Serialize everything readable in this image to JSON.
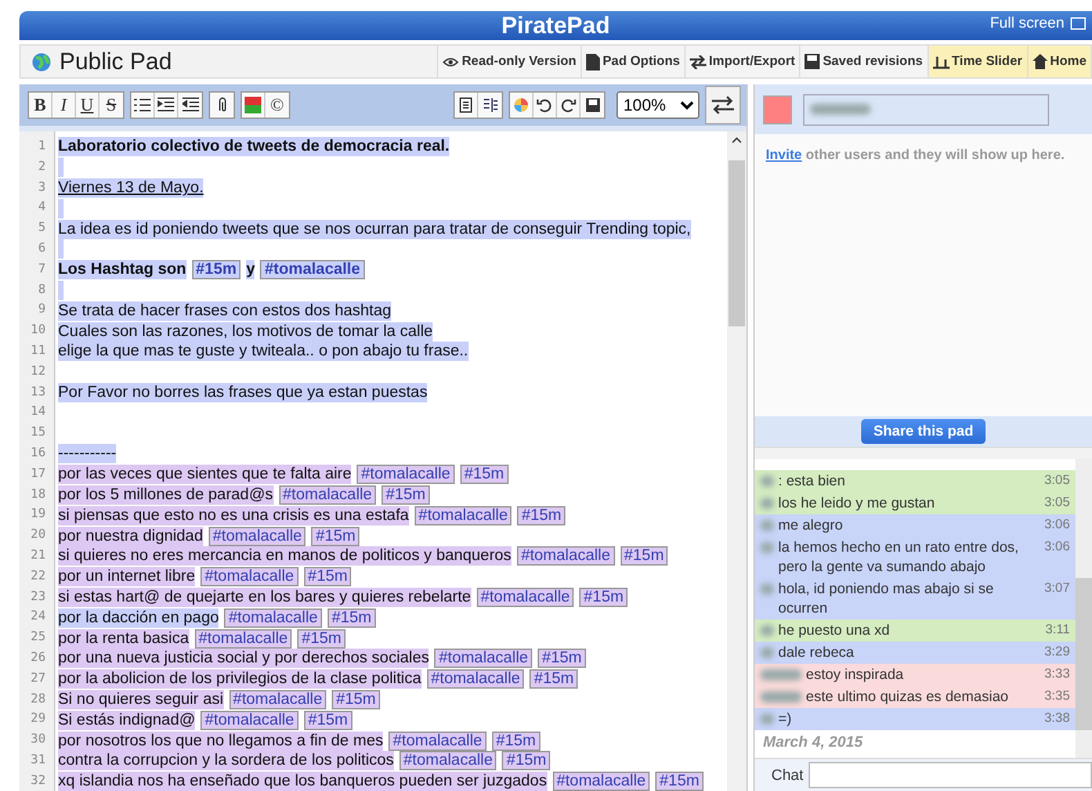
{
  "header": {
    "title": "PiratePad",
    "fullscreen": "Full screen"
  },
  "pad": {
    "title": "Public Pad"
  },
  "pad_actions": [
    {
      "label": "Read-only Version",
      "highlighted": false
    },
    {
      "label": "Pad Options",
      "highlighted": false
    },
    {
      "label": "Import/Export",
      "highlighted": false
    },
    {
      "label": "Saved revisions",
      "highlighted": false
    },
    {
      "label": "Time Slider",
      "highlighted": true
    },
    {
      "label": "Home",
      "highlighted": true
    }
  ],
  "format_buttons": [
    "B",
    "I",
    "U",
    "S"
  ],
  "copyright_button": "©",
  "zoom": "100%",
  "lines": [
    {
      "number": "1",
      "segments": [
        {
          "kind": "text",
          "text": "Laboratorio colectivo de tweets de democracia real.",
          "color": "#c8d0fa",
          "bold": true,
          "underline": false
        }
      ]
    },
    {
      "number": "2",
      "color": "#c8d0fa"
    },
    {
      "number": "3",
      "segments": [
        {
          "kind": "text",
          "text": " Viernes 13 de Mayo. ",
          "color": "#c8d0fa",
          "bold": false,
          "underline": true
        }
      ]
    },
    {
      "number": "4",
      "color": "#c8d0fa"
    },
    {
      "number": "5",
      "segments": [
        {
          "kind": "text",
          "text": " La idea es id poniendo tweets que se nos ocurran para tratar de conseguir Trending topic,",
          "color": "#c8d0fa",
          "bold": false,
          "underline": false
        }
      ]
    },
    {
      "number": "6",
      "color": "#c8d0fa"
    },
    {
      "number": "7",
      "segments": [
        {
          "kind": "text",
          "text": " Los Hashtag son",
          "color": "#c8d0fa",
          "bold": true,
          "underline": false
        },
        {
          "kind": "hashtag",
          "text": "#15m",
          "color": "#c8d0fa",
          "bold": true
        },
        {
          "kind": "text",
          "text": "y",
          "color": "#c8d0fa",
          "bold": true,
          "underline": false
        },
        {
          "kind": "hashtag",
          "text": "#tomalacalle",
          "color": "#c8d0fa",
          "bold": true
        }
      ]
    },
    {
      "number": "8",
      "color": "#c8d0fa"
    },
    {
      "number": "9",
      "segments": [
        {
          "kind": "text",
          "text": "Se trata de hacer frases con estos dos hashtag",
          "color": "#c8d0fa",
          "bold": false,
          "underline": false
        }
      ]
    },
    {
      "number": "10",
      "segments": [
        {
          "kind": "text",
          "text": "Cuales son las razones, los motivos de tomar la calle",
          "color": "#c8d0fa",
          "bold": false,
          "underline": false
        }
      ]
    },
    {
      "number": "11",
      "segments": [
        {
          "kind": "text",
          "text": "elige la que mas te guste y twiteala.. o pon abajo tu frase..",
          "color": "#c8d0fa",
          "bold": false,
          "underline": false
        }
      ]
    },
    {
      "number": "12"
    },
    {
      "number": "13",
      "segments": [
        {
          "kind": "text",
          "text": "Por Favor no borres las frases que ya estan puestas",
          "color": "#c8d0fa",
          "bold": false,
          "underline": false
        }
      ]
    },
    {
      "number": "14"
    },
    {
      "number": "15"
    },
    {
      "number": "16",
      "segments": [
        {
          "kind": "text",
          "text": "-----------",
          "color": "#c8d0fa",
          "bold": false,
          "underline": false
        }
      ]
    },
    {
      "number": "17",
      "segments": [
        {
          "kind": "text",
          "text": "por las veces que sientes que te falta aire",
          "color": "#dcc8f2",
          "bold": false,
          "underline": false
        },
        {
          "kind": "hashtag",
          "text": "#tomalacalle",
          "color": "#dcc8f2",
          "bold": false
        },
        {
          "kind": "hashtag",
          "text": "#15m",
          "color": "#dcc8f2",
          "bold": false
        }
      ]
    },
    {
      "number": "18",
      "segments": [
        {
          "kind": "text",
          "text": "por los 5 millones de parad@s",
          "color": "#dcc8f2",
          "bold": false,
          "underline": false
        },
        {
          "kind": "hashtag",
          "text": "#tomalacalle",
          "color": "#dcc8f2",
          "bold": false
        },
        {
          "kind": "hashtag",
          "text": "#15m",
          "color": "#dcc8f2",
          "bold": false
        }
      ]
    },
    {
      "number": "19",
      "segments": [
        {
          "kind": "text",
          "text": "si piensas que esto no es una crisis es una estafa",
          "color": "#dcc8f2",
          "bold": false,
          "underline": false
        },
        {
          "kind": "hashtag",
          "text": "#tomalacalle",
          "color": "#dcc8f2",
          "bold": false
        },
        {
          "kind": "hashtag",
          "text": "#15m",
          "color": "#dcc8f2",
          "bold": false
        }
      ]
    },
    {
      "number": "20",
      "segments": [
        {
          "kind": "text",
          "text": "por nuestra dignidad",
          "color": "#dcc8f2",
          "bold": false,
          "underline": false
        },
        {
          "kind": "hashtag",
          "text": "#tomalacalle",
          "color": "#dcc8f2",
          "bold": false
        },
        {
          "kind": "hashtag",
          "text": "#15m",
          "color": "#dcc8f2",
          "bold": false
        }
      ]
    },
    {
      "number": "21",
      "segments": [
        {
          "kind": "text",
          "text": "si quieres no eres mercancia en manos de politicos y banqueros",
          "color": "#dcc8f2",
          "bold": false,
          "underline": false
        },
        {
          "kind": "hashtag",
          "text": "#tomalacalle",
          "color": "#dcc8f2",
          "bold": false
        },
        {
          "kind": "hashtag",
          "text": "#15m",
          "color": "#dcc8f2",
          "bold": false
        }
      ]
    },
    {
      "number": "22",
      "segments": [
        {
          "kind": "text",
          "text": "por un internet libre",
          "color": "#dcc8f2",
          "bold": false,
          "underline": false
        },
        {
          "kind": "hashtag",
          "text": "#tomalacalle",
          "color": "#dcc8f2",
          "bold": false
        },
        {
          "kind": "hashtag",
          "text": "#15m",
          "color": "#dcc8f2",
          "bold": false
        }
      ]
    },
    {
      "number": "23",
      "segments": [
        {
          "kind": "text",
          "text": "si estas hart@ de quejarte en los bares y quieres rebelarte",
          "color": "#dcc8f2",
          "bold": false,
          "underline": false
        },
        {
          "kind": "hashtag",
          "text": "#tomalacalle",
          "color": "#dcc8f2",
          "bold": false
        },
        {
          "kind": "hashtag",
          "text": "#15m",
          "color": "#dcc8f2",
          "bold": false
        }
      ]
    },
    {
      "number": "24",
      "segments": [
        {
          "kind": "text",
          "text": "por la dacción en pago",
          "color": "#c8d0fa",
          "bold": false,
          "underline": false
        },
        {
          "kind": "hashtag",
          "text": "#tomalacalle",
          "color": "#dcc8f2",
          "bold": false
        },
        {
          "kind": "hashtag",
          "text": "#15m",
          "color": "#dcc8f2",
          "bold": false
        }
      ]
    },
    {
      "number": "25",
      "segments": [
        {
          "kind": "text",
          "text": "por la renta basica",
          "color": "#dcc8f2",
          "bold": false,
          "underline": false
        },
        {
          "kind": "hashtag",
          "text": "#tomalacalle",
          "color": "#dcc8f2",
          "bold": false
        },
        {
          "kind": "hashtag",
          "text": "#15m",
          "color": "#dcc8f2",
          "bold": false
        }
      ]
    },
    {
      "number": "26",
      "segments": [
        {
          "kind": "text",
          "text": "por una nueva justicia social y por derechos sociales",
          "color": "#dcc8f2",
          "bold": false,
          "underline": false
        },
        {
          "kind": "hashtag",
          "text": "#tomalacalle",
          "color": "#dcc8f2",
          "bold": false
        },
        {
          "kind": "hashtag",
          "text": "#15m",
          "color": "#dcc8f2",
          "bold": false
        }
      ]
    },
    {
      "number": "27",
      "segments": [
        {
          "kind": "text",
          "text": "por la abolicion de los privilegios de la clase politica",
          "color": "#dcc8f2",
          "bold": false,
          "underline": false
        },
        {
          "kind": "hashtag",
          "text": "#tomalacalle",
          "color": "#dcc8f2",
          "bold": false
        },
        {
          "kind": "hashtag",
          "text": "#15m",
          "color": "#dcc8f2",
          "bold": false
        }
      ]
    },
    {
      "number": "28",
      "segments": [
        {
          "kind": "text",
          "text": "Si no quieres seguir asi",
          "color": "#dcc8f2",
          "bold": false,
          "underline": false
        },
        {
          "kind": "hashtag",
          "text": "#tomalacalle",
          "color": "#dcc8f2",
          "bold": false
        },
        {
          "kind": "hashtag",
          "text": "#15m",
          "color": "#dcc8f2",
          "bold": false
        }
      ]
    },
    {
      "number": "29",
      "segments": [
        {
          "kind": "text",
          "text": "Si estás indignad@",
          "color": "#dcc8f2",
          "bold": false,
          "underline": false
        },
        {
          "kind": "hashtag",
          "text": "#tomalacalle",
          "color": "#dcc8f2",
          "bold": false
        },
        {
          "kind": "hashtag",
          "text": "#15m",
          "color": "#dcc8f2",
          "bold": false
        }
      ]
    },
    {
      "number": "30",
      "segments": [
        {
          "kind": "text",
          "text": "por nosotros los que no llegamos a fin de mes",
          "color": "#dcc8f2",
          "bold": false,
          "underline": false
        },
        {
          "kind": "hashtag",
          "text": "#tomalacalle",
          "color": "#dcc8f2",
          "bold": false
        },
        {
          "kind": "hashtag",
          "text": "#15m",
          "color": "#dcc8f2",
          "bold": false
        }
      ]
    },
    {
      "number": "31",
      "segments": [
        {
          "kind": "text",
          "text": "contra la corrupcion y la sordera de los politicos",
          "color": "#dcc8f2",
          "bold": false,
          "underline": false
        },
        {
          "kind": "hashtag",
          "text": "#tomalacalle",
          "color": "#dcc8f2",
          "bold": false
        },
        {
          "kind": "hashtag",
          "text": "#15m",
          "color": "#dcc8f2",
          "bold": false
        }
      ]
    },
    {
      "number": "32",
      "segments": [
        {
          "kind": "text",
          "text": "xq islandia nos ha enseñado que los banqueros pueden ser juzgados",
          "color": "#dcc8f2",
          "bold": false,
          "underline": false
        },
        {
          "kind": "hashtag",
          "text": "#tomalacalle",
          "color": "#dcc8f2",
          "bold": false
        },
        {
          "kind": "hashtag",
          "text": "#15m",
          "color": "#dcc8f2",
          "bold": false
        }
      ]
    }
  ],
  "user": {
    "color": "#ff8080"
  },
  "invite": {
    "link": "Invite",
    "text": "other users and they will show up here."
  },
  "share_button": "Share this pad",
  "chat": {
    "messages": [
      {
        "text": ": esta bien",
        "time": "3:05",
        "color": "#d4ecc0"
      },
      {
        "text": "los he leido y me gustan",
        "time": "3:05",
        "color": "#d4ecc0"
      },
      {
        "text": "me alegro",
        "time": "3:06",
        "color": "#c8d4f8"
      },
      {
        "text": "la hemos hecho en un rato entre dos, pero la gente va sumando abajo",
        "time": "3:06",
        "color": "#c8d4f8"
      },
      {
        "text": "hola, id poniendo mas abajo si se ocurren",
        "time": "3:07",
        "color": "#c8d4f8"
      },
      {
        "text": "he puesto una xd",
        "time": "3:11",
        "color": "#d4ecc0"
      },
      {
        "text": "dale rebeca",
        "time": "3:29",
        "color": "#c8d4f8"
      },
      {
        "text": "estoy inspirada",
        "time": "3:33",
        "color": "#fadada"
      },
      {
        "text": "este ultimo quizas es demasiao",
        "time": "3:35",
        "color": "#fadada"
      },
      {
        "text": "=)",
        "time": "3:38",
        "color": "#c8d4f8"
      }
    ],
    "date": "March 4, 2015",
    "input_label": "Chat"
  }
}
